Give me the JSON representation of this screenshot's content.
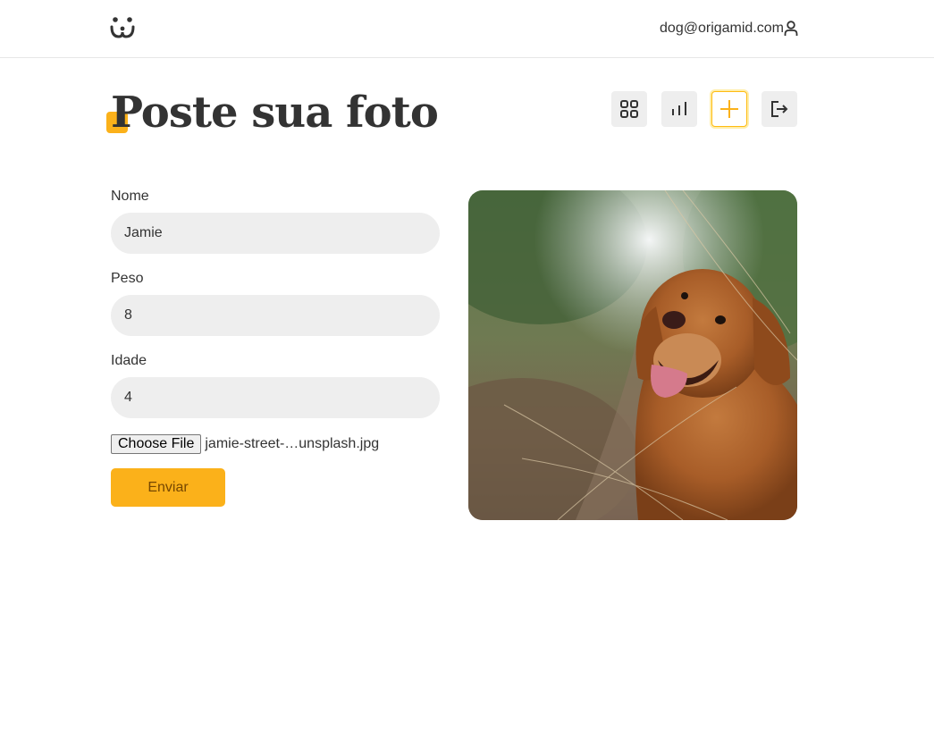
{
  "header": {
    "user_email": "dog@origamid.com",
    "logo_icon": "dog-face-icon",
    "user_icon": "user-icon"
  },
  "page": {
    "title": "Poste sua foto"
  },
  "nav": {
    "items": [
      {
        "icon": "grid-icon",
        "active": false
      },
      {
        "icon": "stats-icon",
        "active": false
      },
      {
        "icon": "plus-icon",
        "active": true
      },
      {
        "icon": "logout-icon",
        "active": false
      }
    ]
  },
  "form": {
    "fields": [
      {
        "label": "Nome",
        "value": "Jamie"
      },
      {
        "label": "Peso",
        "value": "8"
      },
      {
        "label": "Idade",
        "value": "4"
      }
    ],
    "file_button_label": "Choose File",
    "file_name": "jamie-street-…unsplash.jpg",
    "submit_label": "Enviar"
  },
  "colors": {
    "accent": "#fbb11a",
    "accent_text": "#764701",
    "input_bg": "#eeeeee",
    "text": "#333333"
  }
}
